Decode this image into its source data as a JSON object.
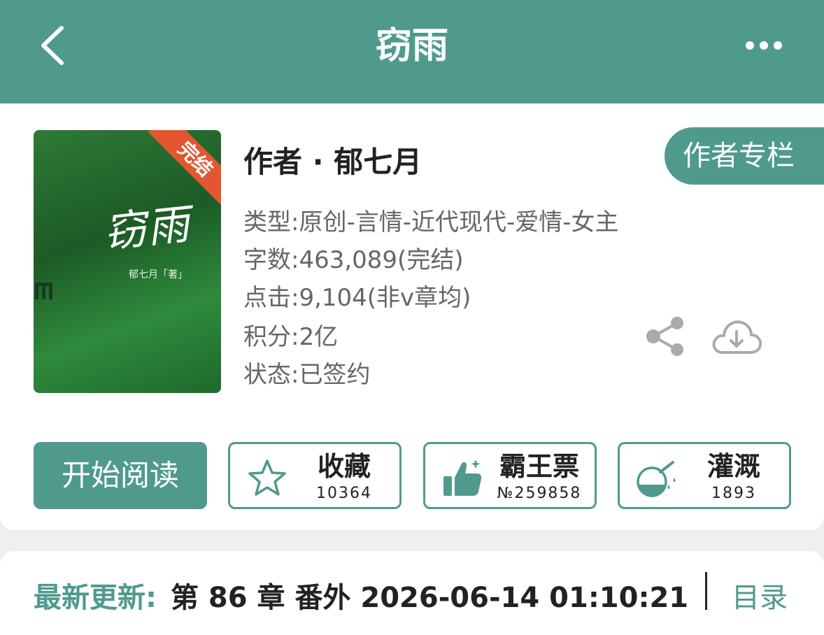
{
  "header": {
    "title": "窃雨"
  },
  "book": {
    "cover_title": "窃雨",
    "cover_author": "郁七月「著」",
    "status_ribbon": "完结",
    "author_line": "作者 · 郁七月",
    "author_column_label": "作者专栏",
    "info": {
      "type": "类型:原创-言情-近代现代-爱情-女主",
      "words": "字数:463,089(完结)",
      "clicks": "点击:9,104(非v章均)",
      "score": "积分:2亿",
      "status": "状态:已签约"
    }
  },
  "actions": {
    "read_label": "开始阅读",
    "collect": {
      "label": "收藏",
      "count": "10364"
    },
    "ticket": {
      "label": "霸王票",
      "count": "№259858"
    },
    "water": {
      "label": "灌溉",
      "count": "1893"
    }
  },
  "update": {
    "label": "最新更新:",
    "text": "第 86 章 番外 2026-06-14 01:10:21",
    "toc_label": "目录"
  },
  "colors": {
    "accent": "#4f9a8d",
    "ribbon": "#e2572f"
  }
}
